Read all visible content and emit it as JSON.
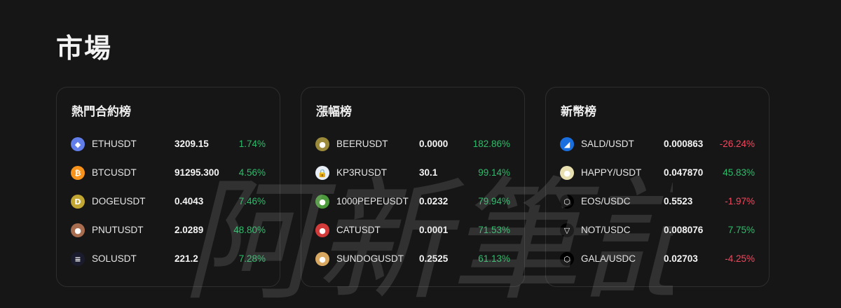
{
  "page": {
    "title": "市場"
  },
  "colors": {
    "up": "#2ebd6b",
    "down": "#f6465d",
    "background": "#161616"
  },
  "watermark": {
    "text": "阿新筆記"
  },
  "hot_contracts": {
    "title": "熱門合約榜",
    "items": [
      {
        "symbol": "ETHUSDT",
        "price": "3209.15",
        "change": "1.74%",
        "direction": "up",
        "icon": "ethereum-icon",
        "icon_color": "#627eea",
        "glyph": "◆"
      },
      {
        "symbol": "BTCUSDT",
        "price": "91295.300",
        "change": "4.56%",
        "direction": "up",
        "icon": "bitcoin-icon",
        "icon_color": "#f7931a",
        "glyph": "₿"
      },
      {
        "symbol": "DOGEUSDT",
        "price": "0.4043",
        "change": "7.46%",
        "direction": "up",
        "icon": "dogecoin-icon",
        "icon_color": "#c2a633",
        "glyph": "D"
      },
      {
        "symbol": "PNUTUSDT",
        "price": "2.0289",
        "change": "48.80%",
        "direction": "up",
        "icon": "pnut-icon",
        "icon_color": "#a86d4e",
        "glyph": "●"
      },
      {
        "symbol": "SOLUSDT",
        "price": "221.2",
        "change": "7.28%",
        "direction": "up",
        "icon": "solana-icon",
        "icon_color": "#1b1b2e",
        "glyph": "≡"
      }
    ]
  },
  "gainers": {
    "title": "漲幅榜",
    "items": [
      {
        "symbol": "BEERUSDT",
        "price": "0.0000",
        "change": "182.86%",
        "direction": "up",
        "icon": "beer-icon",
        "icon_color": "#9a8a3a",
        "glyph": "●"
      },
      {
        "symbol": "KP3RUSDT",
        "price": "30.1",
        "change": "99.14%",
        "direction": "up",
        "icon": "keep3r-icon",
        "icon_color": "#e8eef5",
        "glyph": "🔒"
      },
      {
        "symbol": "1000PEPEUSDT",
        "price": "0.0232",
        "change": "79.94%",
        "direction": "up",
        "icon": "pepe-icon",
        "icon_color": "#4c9a3c",
        "glyph": "●"
      },
      {
        "symbol": "CATUSDT",
        "price": "0.0001",
        "change": "71.53%",
        "direction": "up",
        "icon": "cat-icon",
        "icon_color": "#d33b3b",
        "glyph": "●"
      },
      {
        "symbol": "SUNDOGUSDT",
        "price": "0.2525",
        "change": "61.13%",
        "direction": "up",
        "icon": "sundog-icon",
        "icon_color": "#d9a860",
        "glyph": "●"
      }
    ]
  },
  "new_listings": {
    "title": "新幣榜",
    "items": [
      {
        "symbol": "SALD/USDT",
        "price": "0.000863",
        "change": "-26.24%",
        "direction": "down",
        "icon": "sald-icon",
        "icon_color": "#1a6fe0",
        "glyph": "◢"
      },
      {
        "symbol": "HAPPY/USDT",
        "price": "0.047870",
        "change": "45.83%",
        "direction": "up",
        "icon": "happy-icon",
        "icon_color": "#e8e0b0",
        "glyph": "●"
      },
      {
        "symbol": "EOS/USDC",
        "price": "0.5523",
        "change": "-1.97%",
        "direction": "down",
        "icon": "eos-icon",
        "icon_color": "#000000",
        "glyph": "⬡"
      },
      {
        "symbol": "NOT/USDC",
        "price": "0.008076",
        "change": "7.75%",
        "direction": "up",
        "icon": "notcoin-icon",
        "icon_color": "#000000",
        "glyph": "▽"
      },
      {
        "symbol": "GALA/USDC",
        "price": "0.02703",
        "change": "-4.25%",
        "direction": "down",
        "icon": "gala-icon",
        "icon_color": "#000000",
        "glyph": "⬡"
      }
    ]
  }
}
